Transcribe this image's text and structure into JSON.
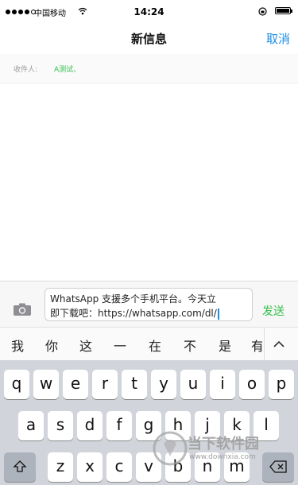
{
  "status_bar": {
    "carrier": "中国移动",
    "time": "14:24"
  },
  "nav": {
    "title": "新信息",
    "cancel_label": "取消"
  },
  "recipients": {
    "label": "收件人:",
    "value": "A测试、"
  },
  "compose": {
    "line1": "WhatsApp 支援多个手机平台。今天立",
    "line2": "即下载吧：https://whatsapp.com/dl/",
    "send_label": "发送"
  },
  "candidates": [
    "我",
    "你",
    "这",
    "一",
    "在",
    "不",
    "是",
    "有"
  ],
  "keyboard": {
    "row1": [
      "q",
      "w",
      "e",
      "r",
      "t",
      "y",
      "u",
      "i",
      "o",
      "p"
    ],
    "row2": [
      "a",
      "s",
      "d",
      "f",
      "g",
      "h",
      "j",
      "k",
      "l"
    ],
    "row3": [
      "z",
      "x",
      "c",
      "v",
      "b",
      "n",
      "m"
    ]
  },
  "watermark": {
    "text": "当下软件园",
    "url": "www.downxia.com"
  },
  "colors": {
    "accent_blue": "#1a8ee6",
    "send_green": "#34c04a",
    "keyboard_bg": "#d1d5db"
  },
  "icons": [
    "wifi-icon",
    "lock-rotation-icon",
    "battery-icon",
    "camera-icon",
    "chevron-up-icon",
    "shift-icon",
    "backspace-icon"
  ]
}
